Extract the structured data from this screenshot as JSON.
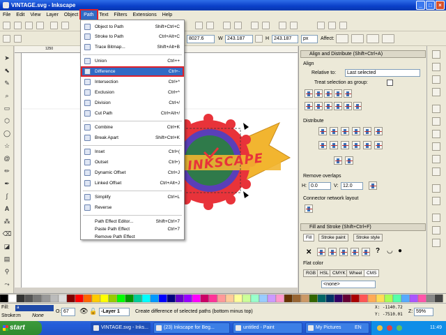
{
  "window": {
    "title": "VINTAGE.svg - Inkscape",
    "min": "_",
    "max": "□",
    "close": "×"
  },
  "menubar": [
    "File",
    "Edit",
    "View",
    "Layer",
    "Object",
    "Path",
    "Text",
    "Filters",
    "Extensions",
    "Help"
  ],
  "toolbar2": {
    "x_value": "8027.6",
    "w_label": "W",
    "w_value": "243.187",
    "h_label": "H",
    "h_value": "243.187",
    "unit": "px",
    "affect_label": "Affect:"
  },
  "path_menu": {
    "items": [
      {
        "label": "Object to Path",
        "shortcut": "Shift+Ctrl+C"
      },
      {
        "label": "Stroke to Path",
        "shortcut": "Ctrl+Alt+C"
      },
      {
        "label": "Trace Bitmap...",
        "shortcut": "Shift+Alt+B"
      },
      {
        "label": "Union",
        "shortcut": "Ctrl++"
      },
      {
        "label": "Difference",
        "shortcut": "Ctrl+-"
      },
      {
        "label": "Intersection",
        "shortcut": "Ctrl+*"
      },
      {
        "label": "Exclusion",
        "shortcut": "Ctrl+^"
      },
      {
        "label": "Division",
        "shortcut": "Ctrl+/"
      },
      {
        "label": "Cut Path",
        "shortcut": "Ctrl+Alt+/"
      },
      {
        "label": "Combine",
        "shortcut": "Ctrl+K"
      },
      {
        "label": "Break Apart",
        "shortcut": "Shift+Ctrl+K"
      },
      {
        "label": "Inset",
        "shortcut": "Ctrl+("
      },
      {
        "label": "Outset",
        "shortcut": "Ctrl+)"
      },
      {
        "label": "Dynamic Offset",
        "shortcut": "Ctrl+J"
      },
      {
        "label": "Linked Offset",
        "shortcut": "Ctrl+Alt+J"
      },
      {
        "label": "Simplify",
        "shortcut": "Ctrl+L"
      },
      {
        "label": "Reverse",
        "shortcut": ""
      },
      {
        "label": "Path Effect Editor...",
        "shortcut": "Shift+Ctrl+7"
      },
      {
        "label": "Paste Path Effect",
        "shortcut": "Ctrl+7"
      },
      {
        "label": "Remove Path Effect",
        "shortcut": ""
      }
    ]
  },
  "align_panel": {
    "title": "Align and Distribute (Shift+Ctrl+A)",
    "align_label": "Align",
    "relative_label": "Relative to:",
    "relative_value": "Last selected",
    "group_label": "Treat selection as group:",
    "distribute_label": "Distribute",
    "overlap_label": "Remove overlaps",
    "h_label": "H:",
    "h_value": "0.0",
    "v_label": "V:",
    "v_value": "12.0",
    "connector_label": "Connector network layout"
  },
  "fill_panel": {
    "title": "Fill and Stroke (Shift+Ctrl+F)",
    "tabs": [
      "Fill",
      "Stroke paint",
      "Stroke style"
    ],
    "flat_color": "Flat color",
    "color_tabs": [
      "RGB",
      "HSL",
      "CMYK",
      "Wheel",
      "CMS"
    ],
    "none_value": "<none>"
  },
  "canvas": {
    "logo_text": "INKSCAPE",
    "ruler_mark": "1250"
  },
  "status": {
    "fill_label": "Fill:",
    "fill_value": "a",
    "stroke_label": "Stroke:",
    "stroke_value": "m",
    "stroke_none": "None",
    "opacity_label": "O:",
    "opacity_value": "67",
    "layer": "-Layer 1",
    "message": "Create difference of selected paths (bottom minus top)",
    "x_coord": "X: -1140.72",
    "y_coord": "Y: -7510.01",
    "z_label": "Z:",
    "zoom": "59%"
  },
  "taskbar": {
    "start": "start",
    "tasks": [
      "VINTAGE.svg - Inks...",
      "(23) Inkscape for Beg...",
      "untitled - Paint",
      "My Pictures"
    ],
    "lang": "EN",
    "clock": "11:49"
  },
  "colors": {
    "accent": "#316ac5",
    "highlight_outline": "#e0202a",
    "logo_red": "#e8333a",
    "logo_blue": "#5a3fb8",
    "logo_green": "#2f7a4a",
    "logo_yellow": "#f2b530"
  }
}
